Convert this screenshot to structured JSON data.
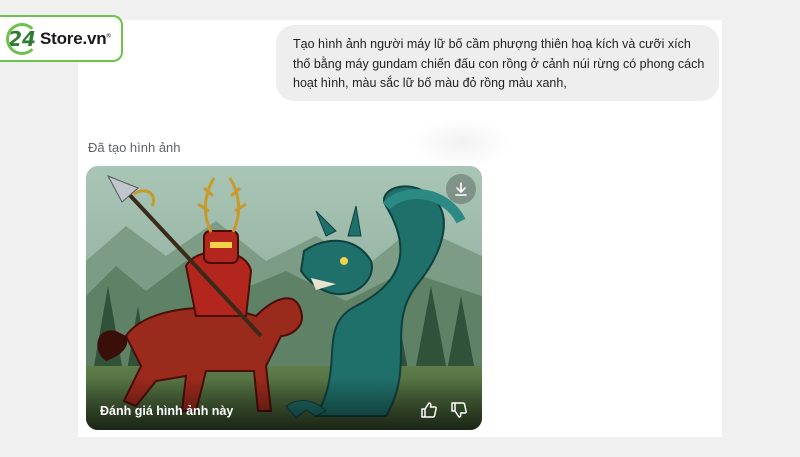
{
  "brand": {
    "number": "24",
    "name": "Store.vn",
    "reg": "®"
  },
  "chat": {
    "user_prompt": "Tạo hình ảnh người máy lữ bố cầm phượng thiên hoạ kích và cưỡi xích thố bằng máy gundam chiến đấu con rồng ở cảnh núi rừng có phong cách hoạt hình, màu sắc lữ bố màu đỏ rồng màu xanh,",
    "status_label": "Đã tạo hình ảnh"
  },
  "image_card": {
    "rate_label": "Đánh giá hình ảnh này",
    "download_icon": "download-icon",
    "thumbs_up_icon": "thumbs-up-icon",
    "thumbs_down_icon": "thumbs-down-icon"
  },
  "colors": {
    "brand_green": "#6cc24a",
    "bubble_bg": "#eeeeee",
    "robot_red": "#b3261e",
    "dragon_teal": "#1f6f6a"
  }
}
